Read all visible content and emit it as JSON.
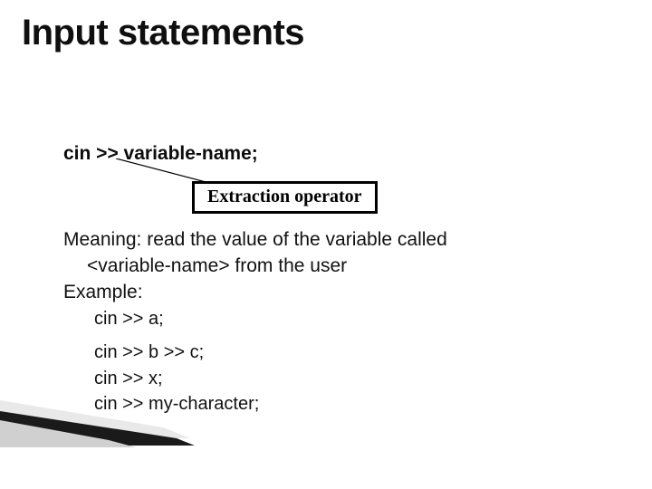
{
  "title": "Input statements",
  "syntax": "cin >> variable-name;",
  "callout": "Extraction operator",
  "meaning_line1": "Meaning: read the value of the variable called",
  "meaning_line2": "<variable-name> from the user",
  "example_label": "Example:",
  "code": {
    "l1": "cin >> a;",
    "l2": "cin >> b >> c;",
    "l3": "cin >> x;",
    "l4": "cin >> my-character;"
  }
}
